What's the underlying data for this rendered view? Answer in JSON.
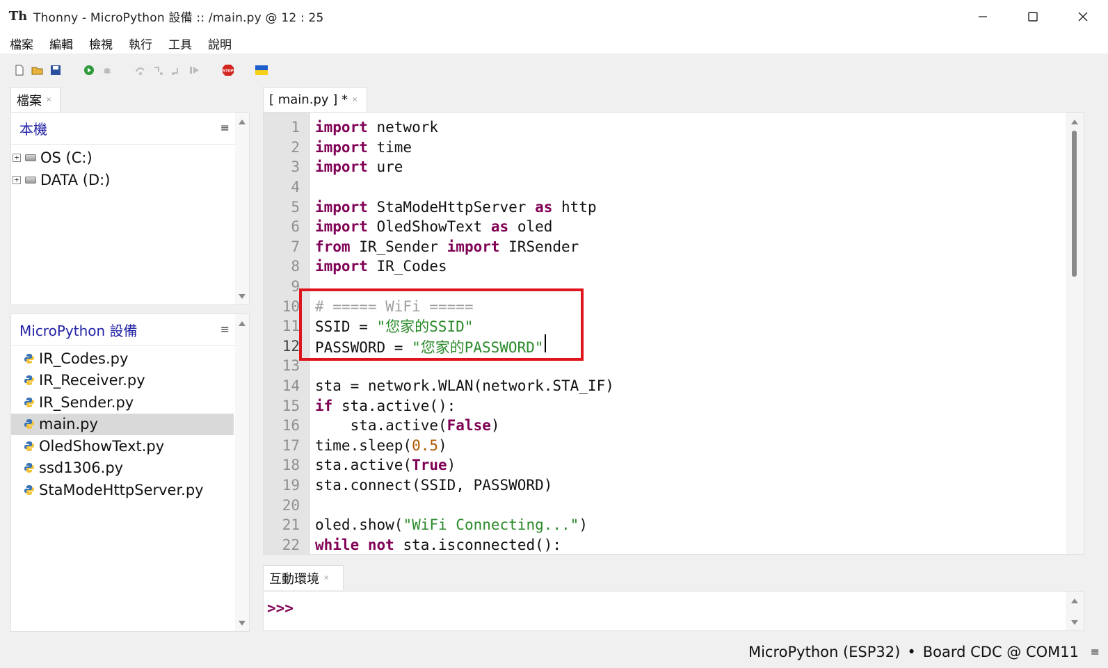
{
  "window": {
    "title": "Thonny  -  MicroPython 設備 :: /main.py  @  12 : 25",
    "minimize": "—",
    "maximize": "☐",
    "close": "✕"
  },
  "menu": [
    "檔案",
    "編輯",
    "檢視",
    "執行",
    "工具",
    "說明"
  ],
  "files_tab": {
    "label": "檔案",
    "close": "×"
  },
  "local_panel": {
    "title": "本機",
    "menu": "≡",
    "drives": [
      "OS (C:)",
      "DATA (D:)"
    ]
  },
  "device_panel": {
    "title": "MicroPython 設備",
    "menu": "≡",
    "files": [
      "IR_Codes.py",
      "IR_Receiver.py",
      "IR_Sender.py",
      "main.py",
      "OledShowText.py",
      "ssd1306.py",
      "StaModeHttpServer.py"
    ],
    "selected": "main.py"
  },
  "editor_tab": {
    "label": "[ main.py ] *",
    "close": "×"
  },
  "code": {
    "current_line": 12,
    "lines": [
      "import network",
      "import time",
      "import ure",
      "",
      "import StaModeHttpServer as http",
      "import OledShowText as oled",
      "from IR_Sender import IRSender",
      "import IR_Codes",
      "",
      "# ===== WiFi =====",
      "SSID = \"您家的SSID\"",
      "PASSWORD = \"您家的PASSWORD\"",
      "",
      "sta = network.WLAN(network.STA_IF)",
      "if sta.active():",
      "    sta.active(False)",
      "time.sleep(0.5)",
      "sta.active(True)",
      "sta.connect(SSID, PASSWORD)",
      "",
      "oled.show(\"WiFi Connecting...\")",
      "while not sta.isconnected():"
    ]
  },
  "shell_tab": {
    "label": "互動環境",
    "close": "×"
  },
  "shell": {
    "prompt": ">>>"
  },
  "status": {
    "interpreter": "MicroPython (ESP32)",
    "separator": "•",
    "port": "Board CDC @ COM11",
    "menu": "≡"
  },
  "colors": {
    "keyword": "#7f0055",
    "string": "#2a8a2a",
    "comment": "#a0a0a0",
    "number": "#b05a00",
    "highlight_box": "#e0141c"
  }
}
